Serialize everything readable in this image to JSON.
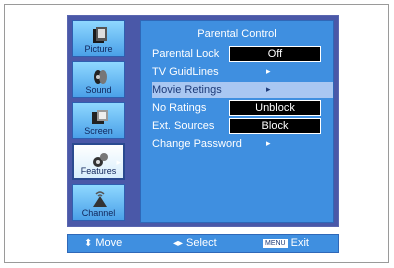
{
  "sidebar": {
    "items": [
      {
        "label": "Picture",
        "icon": "picture-icon"
      },
      {
        "label": "Sound",
        "icon": "sound-icon"
      },
      {
        "label": "Screen",
        "icon": "screen-icon"
      },
      {
        "label": "Features",
        "icon": "features-icon",
        "active": true
      },
      {
        "label": "Channel",
        "icon": "channel-icon"
      }
    ]
  },
  "panel": {
    "title": "Parental Control",
    "rows": [
      {
        "label": "Parental Lock",
        "value": "Off"
      },
      {
        "label": "TV GuidLines",
        "value": "▸"
      },
      {
        "label": "Movie Retings",
        "value": "▸",
        "selected": true
      },
      {
        "label": "No Ratings",
        "value": "Unblock"
      },
      {
        "label": "Ext. Sources",
        "value": "Block"
      },
      {
        "label": "Change Password",
        "value": "▸"
      }
    ]
  },
  "footer": {
    "move_glyph": "⬍",
    "move_label": "Move",
    "select_glyph": "◂▸",
    "select_label": "Select",
    "exit_key": "MENU",
    "exit_label": "Exit"
  },
  "colors": {
    "osd_bg": "#4a58a8",
    "panel_bg": "#3f8fe0",
    "selected_row": "#a9c7f2"
  }
}
